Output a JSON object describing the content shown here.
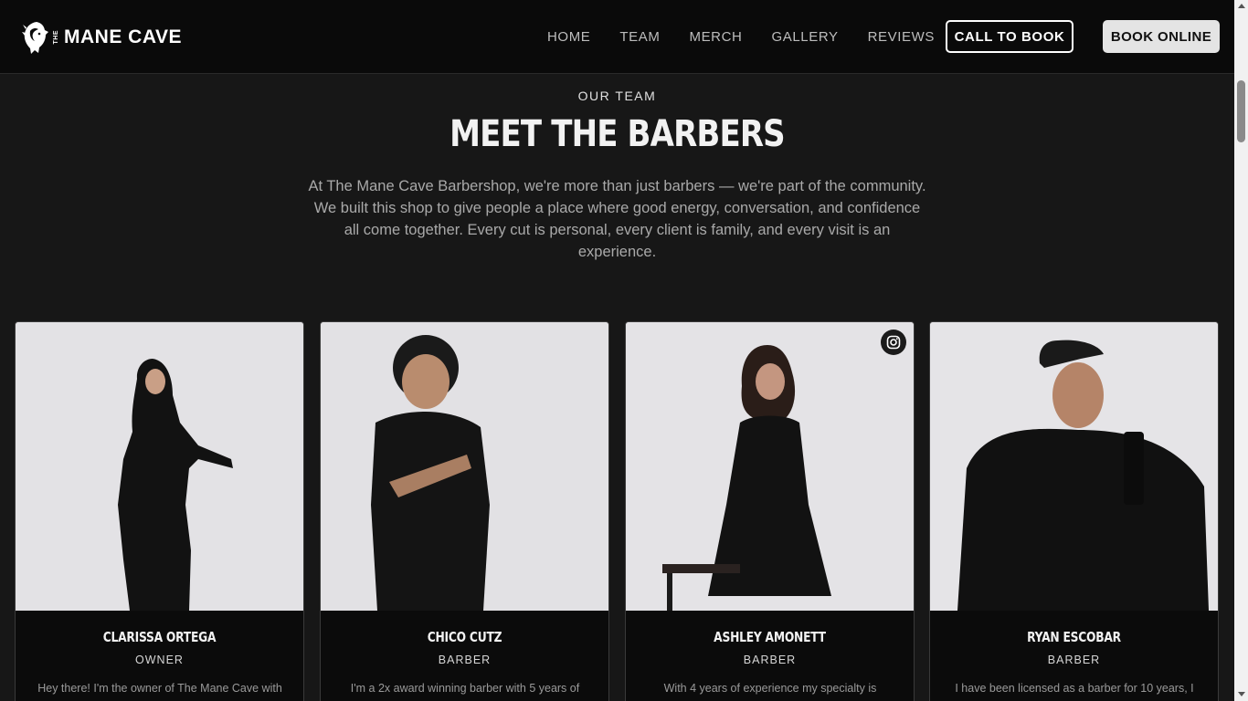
{
  "header": {
    "logo_small": "THE",
    "logo_text": "MANE CAVE",
    "nav": [
      "HOME",
      "TEAM",
      "MERCH",
      "GALLERY",
      "REVIEWS"
    ],
    "call_button": "CALL TO BOOK",
    "book_button": "BOOK ONLINE"
  },
  "hero": {
    "eyebrow": "OUR TEAM",
    "title": "MEET THE BARBERS",
    "intro": "At The Mane Cave Barbershop, we're more than just barbers — we're part of the community. We built this shop to give people a place where good energy, conversation, and confidence all come together. Every cut is personal, every client is family, and every visit is an experience."
  },
  "team": [
    {
      "name": "CLARISSA ORTEGA",
      "role": "OWNER",
      "bio": "Hey there! I'm the owner of The Mane Cave with",
      "instagram": false
    },
    {
      "name": "CHICO CUTZ",
      "role": "BARBER",
      "bio": "I'm a 2x award winning barber with 5 years of",
      "instagram": false
    },
    {
      "name": "ASHLEY AMONETT",
      "role": "BARBER",
      "bio": "With 4 years of experience my specialty is",
      "instagram": true
    },
    {
      "name": "RYAN ESCOBAR",
      "role": "BARBER",
      "bio": "I have been licensed as a barber for 10 years, I",
      "instagram": false
    }
  ],
  "colors": {
    "header_bg": "#0a0a0a",
    "page_bg": "#171717",
    "card_bg": "#0b0b0b",
    "book_button_bg": "#e4e4e4"
  },
  "icons": [
    "lion-logo-icon",
    "instagram-icon"
  ]
}
